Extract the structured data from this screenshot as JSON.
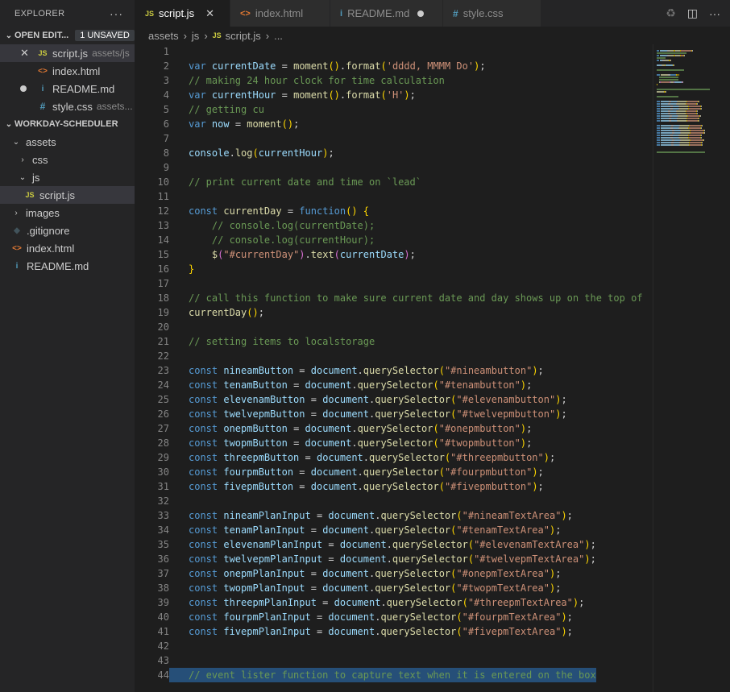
{
  "sidebar": {
    "title": "EXPLORER",
    "more": "···",
    "open_editors": {
      "label": "OPEN EDIT...",
      "badge": "1 UNSAVED",
      "items": [
        {
          "icon": "JS",
          "name": "script.js",
          "hint": "assets/js"
        },
        {
          "icon": "<>",
          "name": "index.html",
          "hint": ""
        },
        {
          "icon": "i",
          "name": "README.md",
          "hint": ""
        },
        {
          "icon": "#",
          "name": "style.css",
          "hint": "assets..."
        }
      ]
    },
    "project": {
      "label": "WORKDAY-SCHEDULER",
      "tree": [
        {
          "name": "assets"
        },
        {
          "name": "css"
        },
        {
          "name": "js"
        },
        {
          "name": "script.js",
          "icon": "JS"
        },
        {
          "name": "images"
        },
        {
          "name": ".gitignore"
        },
        {
          "name": "index.html",
          "icon": "<>"
        },
        {
          "name": "README.md",
          "icon": "i"
        }
      ]
    }
  },
  "tabs": [
    {
      "icon": "JS",
      "label": "script.js"
    },
    {
      "icon": "<>",
      "label": "index.html"
    },
    {
      "icon": "i",
      "label": "README.md"
    },
    {
      "icon": "#",
      "label": "style.css"
    }
  ],
  "breadcrumb": [
    "assets",
    "js",
    "script.js",
    "..."
  ],
  "breadcrumb_js_icon": "JS",
  "colors": {
    "keyword": "#569cd6",
    "variable": "#9cdcfe",
    "function": "#dcdcaa",
    "string": "#ce9178",
    "comment": "#6a9955"
  },
  "code_lines": [
    [],
    [
      [
        "kw",
        "var"
      ],
      [
        "pl",
        " "
      ],
      [
        "var",
        "currentDate"
      ],
      [
        "pl",
        " = "
      ],
      [
        "fn",
        "moment"
      ],
      [
        "br",
        "()"
      ],
      [
        "pl",
        "."
      ],
      [
        "fn",
        "format"
      ],
      [
        "br",
        "("
      ],
      [
        "str",
        "'dddd, MMMM Do'"
      ],
      [
        "br",
        ")"
      ],
      [
        "pl",
        ";"
      ]
    ],
    [
      [
        "cm",
        "// making 24 hour clock for time calculation"
      ]
    ],
    [
      [
        "kw",
        "var"
      ],
      [
        "pl",
        " "
      ],
      [
        "var",
        "currentHour"
      ],
      [
        "pl",
        " = "
      ],
      [
        "fn",
        "moment"
      ],
      [
        "br",
        "()"
      ],
      [
        "pl",
        "."
      ],
      [
        "fn",
        "format"
      ],
      [
        "br",
        "("
      ],
      [
        "str",
        "'H'"
      ],
      [
        "br",
        ")"
      ],
      [
        "pl",
        ";"
      ]
    ],
    [
      [
        "cm",
        "// getting cu"
      ]
    ],
    [
      [
        "kw",
        "var"
      ],
      [
        "pl",
        " "
      ],
      [
        "var",
        "now"
      ],
      [
        "pl",
        " = "
      ],
      [
        "fn",
        "moment"
      ],
      [
        "br",
        "()"
      ],
      [
        "pl",
        ";"
      ]
    ],
    [],
    [
      [
        "var",
        "console"
      ],
      [
        "pl",
        "."
      ],
      [
        "fn",
        "log"
      ],
      [
        "br",
        "("
      ],
      [
        "var",
        "currentHour"
      ],
      [
        "br",
        ")"
      ],
      [
        "pl",
        ";"
      ]
    ],
    [],
    [
      [
        "cm",
        "// print current date and time on `lead`"
      ]
    ],
    [],
    [
      [
        "kw",
        "const"
      ],
      [
        "pl",
        " "
      ],
      [
        "fn",
        "currentDay"
      ],
      [
        "pl",
        " = "
      ],
      [
        "kw",
        "function"
      ],
      [
        "br",
        "()"
      ],
      [
        "pl",
        " "
      ],
      [
        "br",
        "{"
      ]
    ],
    [
      [
        "pl",
        "    "
      ],
      [
        "cm",
        "// console.log(currentDate);"
      ]
    ],
    [
      [
        "pl",
        "    "
      ],
      [
        "cm",
        "// console.log(currentHour);"
      ]
    ],
    [
      [
        "pl",
        "    "
      ],
      [
        "fn",
        "$"
      ],
      [
        "br2",
        "("
      ],
      [
        "str",
        "\"#currentDay\""
      ],
      [
        "br2",
        ")"
      ],
      [
        "pl",
        "."
      ],
      [
        "fn",
        "text"
      ],
      [
        "br2",
        "("
      ],
      [
        "var",
        "currentDate"
      ],
      [
        "br2",
        ")"
      ],
      [
        "pl",
        ";"
      ]
    ],
    [
      [
        "br",
        "}"
      ]
    ],
    [],
    [
      [
        "cm",
        "// call this function to make sure current date and day shows up on the top of"
      ]
    ],
    [
      [
        "fn",
        "currentDay"
      ],
      [
        "br",
        "()"
      ],
      [
        "pl",
        ";"
      ]
    ],
    [],
    [
      [
        "cm",
        "// setting items to localstorage"
      ]
    ],
    [],
    [
      [
        "kw",
        "const"
      ],
      [
        "pl",
        " "
      ],
      [
        "var",
        "nineamButton"
      ],
      [
        "pl",
        " = "
      ],
      [
        "var",
        "document"
      ],
      [
        "pl",
        "."
      ],
      [
        "fn",
        "querySelector"
      ],
      [
        "br",
        "("
      ],
      [
        "str",
        "\"#nineambutton\""
      ],
      [
        "br",
        ")"
      ],
      [
        "pl",
        ";"
      ]
    ],
    [
      [
        "kw",
        "const"
      ],
      [
        "pl",
        " "
      ],
      [
        "var",
        "tenamButton"
      ],
      [
        "pl",
        " = "
      ],
      [
        "var",
        "document"
      ],
      [
        "pl",
        "."
      ],
      [
        "fn",
        "querySelector"
      ],
      [
        "br",
        "("
      ],
      [
        "str",
        "\"#tenambutton\""
      ],
      [
        "br",
        ")"
      ],
      [
        "pl",
        ";"
      ]
    ],
    [
      [
        "kw",
        "const"
      ],
      [
        "pl",
        " "
      ],
      [
        "var",
        "elevenamButton"
      ],
      [
        "pl",
        " = "
      ],
      [
        "var",
        "document"
      ],
      [
        "pl",
        "."
      ],
      [
        "fn",
        "querySelector"
      ],
      [
        "br",
        "("
      ],
      [
        "str",
        "\"#elevenambutton\""
      ],
      [
        "br",
        ")"
      ],
      [
        "pl",
        ";"
      ]
    ],
    [
      [
        "kw",
        "const"
      ],
      [
        "pl",
        " "
      ],
      [
        "var",
        "twelvepmButton"
      ],
      [
        "pl",
        " = "
      ],
      [
        "var",
        "document"
      ],
      [
        "pl",
        "."
      ],
      [
        "fn",
        "querySelector"
      ],
      [
        "br",
        "("
      ],
      [
        "str",
        "\"#twelvepmbutton\""
      ],
      [
        "br",
        ")"
      ],
      [
        "pl",
        ";"
      ]
    ],
    [
      [
        "kw",
        "const"
      ],
      [
        "pl",
        " "
      ],
      [
        "var",
        "onepmButton"
      ],
      [
        "pl",
        " = "
      ],
      [
        "var",
        "document"
      ],
      [
        "pl",
        "."
      ],
      [
        "fn",
        "querySelector"
      ],
      [
        "br",
        "("
      ],
      [
        "str",
        "\"#onepmbutton\""
      ],
      [
        "br",
        ")"
      ],
      [
        "pl",
        ";"
      ]
    ],
    [
      [
        "kw",
        "const"
      ],
      [
        "pl",
        " "
      ],
      [
        "var",
        "twopmButton"
      ],
      [
        "pl",
        " = "
      ],
      [
        "var",
        "document"
      ],
      [
        "pl",
        "."
      ],
      [
        "fn",
        "querySelector"
      ],
      [
        "br",
        "("
      ],
      [
        "str",
        "\"#twopmbutton\""
      ],
      [
        "br",
        ")"
      ],
      [
        "pl",
        ";"
      ]
    ],
    [
      [
        "kw",
        "const"
      ],
      [
        "pl",
        " "
      ],
      [
        "var",
        "threepmButton"
      ],
      [
        "pl",
        " = "
      ],
      [
        "var",
        "document"
      ],
      [
        "pl",
        "."
      ],
      [
        "fn",
        "querySelector"
      ],
      [
        "br",
        "("
      ],
      [
        "str",
        "\"#threepmbutton\""
      ],
      [
        "br",
        ")"
      ],
      [
        "pl",
        ";"
      ]
    ],
    [
      [
        "kw",
        "const"
      ],
      [
        "pl",
        " "
      ],
      [
        "var",
        "fourpmButton"
      ],
      [
        "pl",
        " = "
      ],
      [
        "var",
        "document"
      ],
      [
        "pl",
        "."
      ],
      [
        "fn",
        "querySelector"
      ],
      [
        "br",
        "("
      ],
      [
        "str",
        "\"#fourpmbutton\""
      ],
      [
        "br",
        ")"
      ],
      [
        "pl",
        ";"
      ]
    ],
    [
      [
        "kw",
        "const"
      ],
      [
        "pl",
        " "
      ],
      [
        "var",
        "fivepmButton"
      ],
      [
        "pl",
        " = "
      ],
      [
        "var",
        "document"
      ],
      [
        "pl",
        "."
      ],
      [
        "fn",
        "querySelector"
      ],
      [
        "br",
        "("
      ],
      [
        "str",
        "\"#fivepmbutton\""
      ],
      [
        "br",
        ")"
      ],
      [
        "pl",
        ";"
      ]
    ],
    [],
    [
      [
        "kw",
        "const"
      ],
      [
        "pl",
        " "
      ],
      [
        "var",
        "nineamPlanInput"
      ],
      [
        "pl",
        " = "
      ],
      [
        "var",
        "document"
      ],
      [
        "pl",
        "."
      ],
      [
        "fn",
        "querySelector"
      ],
      [
        "br",
        "("
      ],
      [
        "str",
        "\"#nineamTextArea\""
      ],
      [
        "br",
        ")"
      ],
      [
        "pl",
        ";"
      ]
    ],
    [
      [
        "kw",
        "const"
      ],
      [
        "pl",
        " "
      ],
      [
        "var",
        "tenamPlanInput"
      ],
      [
        "pl",
        " = "
      ],
      [
        "var",
        "document"
      ],
      [
        "pl",
        "."
      ],
      [
        "fn",
        "querySelector"
      ],
      [
        "br",
        "("
      ],
      [
        "str",
        "\"#tenamTextArea\""
      ],
      [
        "br",
        ")"
      ],
      [
        "pl",
        ";"
      ]
    ],
    [
      [
        "kw",
        "const"
      ],
      [
        "pl",
        " "
      ],
      [
        "var",
        "elevenamPlanInput"
      ],
      [
        "pl",
        " = "
      ],
      [
        "var",
        "document"
      ],
      [
        "pl",
        "."
      ],
      [
        "fn",
        "querySelector"
      ],
      [
        "br",
        "("
      ],
      [
        "str",
        "\"#elevenamTextArea\""
      ],
      [
        "br",
        ")"
      ],
      [
        "pl",
        ";"
      ]
    ],
    [
      [
        "kw",
        "const"
      ],
      [
        "pl",
        " "
      ],
      [
        "var",
        "twelvepmPlanInput"
      ],
      [
        "pl",
        " = "
      ],
      [
        "var",
        "document"
      ],
      [
        "pl",
        "."
      ],
      [
        "fn",
        "querySelector"
      ],
      [
        "br",
        "("
      ],
      [
        "str",
        "\"#twelvepmTextArea\""
      ],
      [
        "br",
        ")"
      ],
      [
        "pl",
        ";"
      ]
    ],
    [
      [
        "kw",
        "const"
      ],
      [
        "pl",
        " "
      ],
      [
        "var",
        "onepmPlanInput"
      ],
      [
        "pl",
        " = "
      ],
      [
        "var",
        "document"
      ],
      [
        "pl",
        "."
      ],
      [
        "fn",
        "querySelector"
      ],
      [
        "br",
        "("
      ],
      [
        "str",
        "\"#onepmTextArea\""
      ],
      [
        "br",
        ")"
      ],
      [
        "pl",
        ";"
      ]
    ],
    [
      [
        "kw",
        "const"
      ],
      [
        "pl",
        " "
      ],
      [
        "var",
        "twopmPlanInput"
      ],
      [
        "pl",
        " = "
      ],
      [
        "var",
        "document"
      ],
      [
        "pl",
        "."
      ],
      [
        "fn",
        "querySelector"
      ],
      [
        "br",
        "("
      ],
      [
        "str",
        "\"#twopmTextArea\""
      ],
      [
        "br",
        ")"
      ],
      [
        "pl",
        ";"
      ]
    ],
    [
      [
        "kw",
        "const"
      ],
      [
        "pl",
        " "
      ],
      [
        "var",
        "threepmPlanInput"
      ],
      [
        "pl",
        " = "
      ],
      [
        "var",
        "document"
      ],
      [
        "pl",
        "."
      ],
      [
        "fn",
        "querySelector"
      ],
      [
        "br",
        "("
      ],
      [
        "str",
        "\"#threepmTextArea\""
      ],
      [
        "br",
        ")"
      ],
      [
        "pl",
        ";"
      ]
    ],
    [
      [
        "kw",
        "const"
      ],
      [
        "pl",
        " "
      ],
      [
        "var",
        "fourpmPlanInput"
      ],
      [
        "pl",
        " = "
      ],
      [
        "var",
        "document"
      ],
      [
        "pl",
        "."
      ],
      [
        "fn",
        "querySelector"
      ],
      [
        "br",
        "("
      ],
      [
        "str",
        "\"#fourpmTextArea\""
      ],
      [
        "br",
        ")"
      ],
      [
        "pl",
        ";"
      ]
    ],
    [
      [
        "kw",
        "const"
      ],
      [
        "pl",
        " "
      ],
      [
        "var",
        "fivepmPlanInput"
      ],
      [
        "pl",
        " = "
      ],
      [
        "var",
        "document"
      ],
      [
        "pl",
        "."
      ],
      [
        "fn",
        "querySelector"
      ],
      [
        "br",
        "("
      ],
      [
        "str",
        "\"#fivepmTextArea\""
      ],
      [
        "br",
        ")"
      ],
      [
        "pl",
        ";"
      ]
    ],
    [],
    [],
    [
      [
        "cm",
        "// event lister function to capture text when it is entered on the box"
      ]
    ]
  ],
  "highlighted_line": 44
}
